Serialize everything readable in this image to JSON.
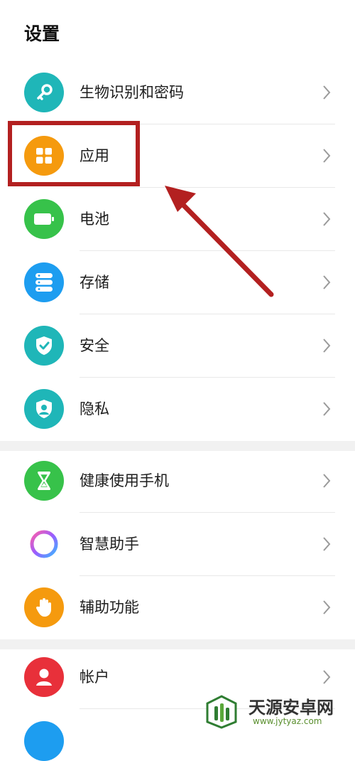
{
  "header": {
    "title": "设置"
  },
  "groups": [
    {
      "items": [
        {
          "label": "生物识别和密码",
          "icon": "key-icon",
          "color": "#1fb6b8"
        },
        {
          "label": "应用",
          "icon": "apps-grid-icon",
          "color": "#f59a0e"
        },
        {
          "label": "电池",
          "icon": "battery-icon",
          "color": "#37c24a"
        },
        {
          "label": "存储",
          "icon": "storage-icon",
          "color": "#1d9df0"
        },
        {
          "label": "安全",
          "icon": "shield-check-icon",
          "color": "#1fb6b8"
        },
        {
          "label": "隐私",
          "icon": "privacy-icon",
          "color": "#1fb6b8"
        }
      ]
    },
    {
      "items": [
        {
          "label": "健康使用手机",
          "icon": "hourglass-icon",
          "color": "#37c24a"
        },
        {
          "label": "智慧助手",
          "icon": "assistant-ring-icon",
          "color": "#ffffff"
        },
        {
          "label": "辅助功能",
          "icon": "hand-icon",
          "color": "#f59a0e"
        }
      ]
    },
    {
      "items": [
        {
          "label": "帐户",
          "icon": "user-icon",
          "color": "#e8303a"
        }
      ]
    }
  ],
  "annotation": {
    "highlight_color": "#b32020",
    "highlighted_item": "应用"
  },
  "watermark": {
    "brand": "天源安卓网",
    "url": "www.jytyaz.com"
  }
}
